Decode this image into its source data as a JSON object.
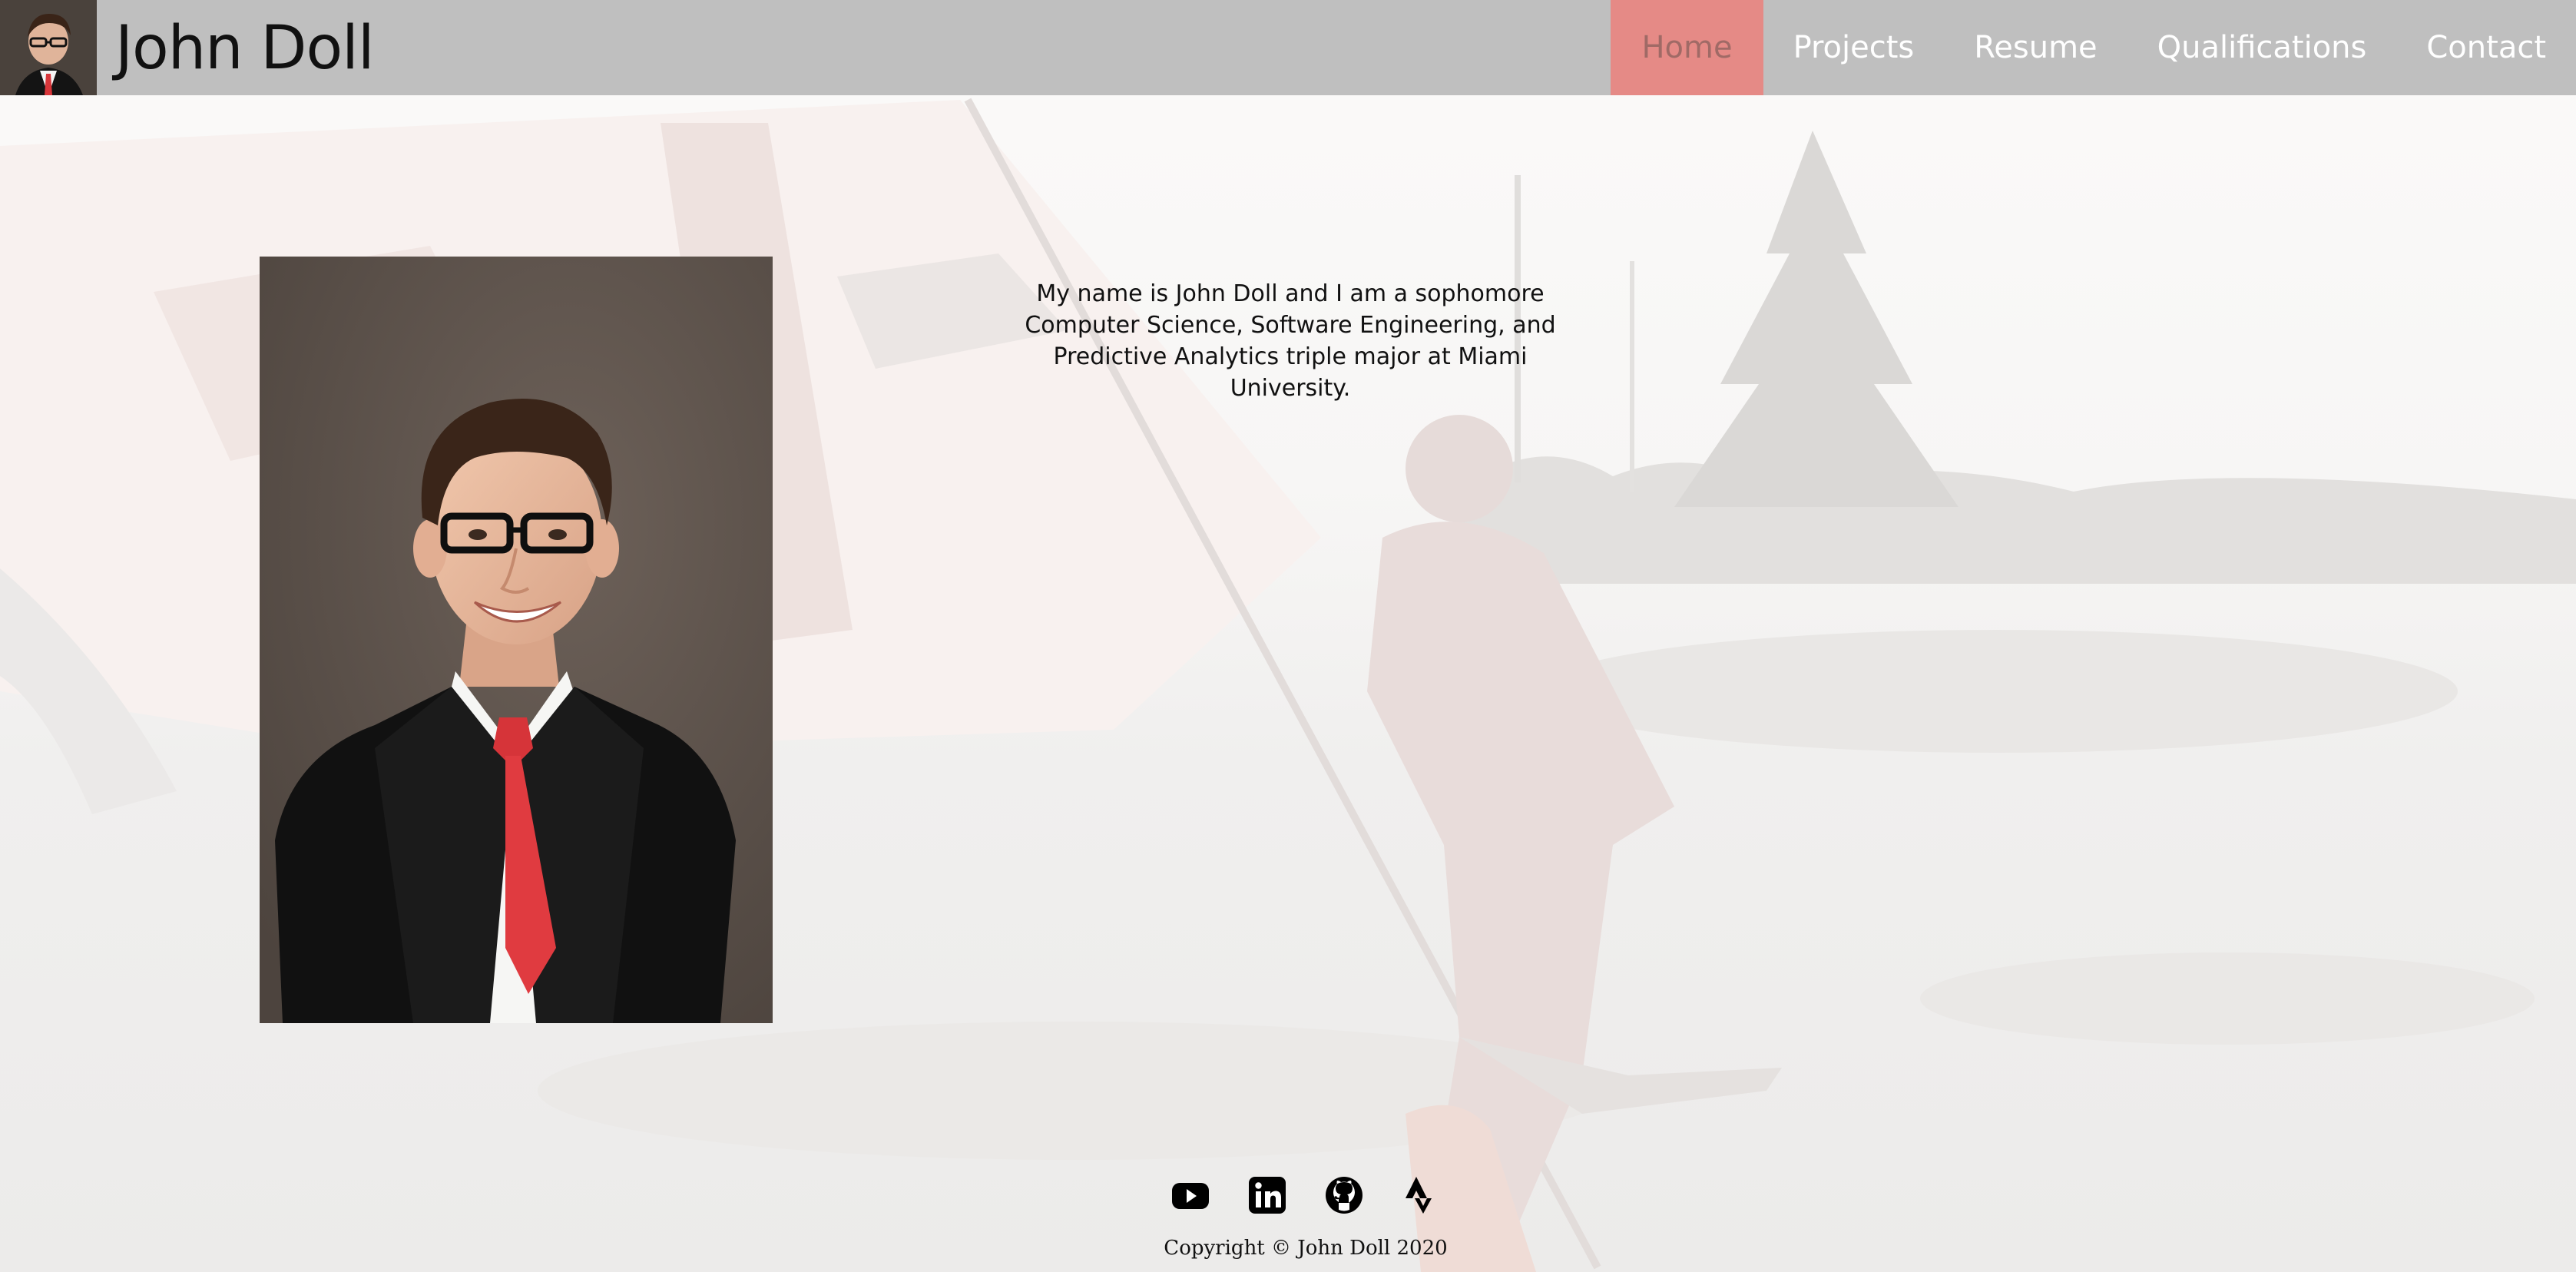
{
  "header": {
    "title": "John Doll",
    "nav": [
      {
        "label": "Home",
        "active": true
      },
      {
        "label": "Projects",
        "active": false
      },
      {
        "label": "Resume",
        "active": false
      },
      {
        "label": "Qualifications",
        "active": false
      },
      {
        "label": "Contact",
        "active": false
      }
    ],
    "accent_color": "#e58a86",
    "bar_color": "#bfbfbf"
  },
  "main": {
    "bio": "My name is John Doll and I am a sophomore Computer Science, Software Engineering, and Predictive Analytics triple major at Miami University."
  },
  "footer": {
    "social_icons": [
      "youtube-icon",
      "linkedin-icon",
      "github-icon",
      "strava-icon"
    ],
    "copyright": "Copyright © John Doll 2020"
  }
}
